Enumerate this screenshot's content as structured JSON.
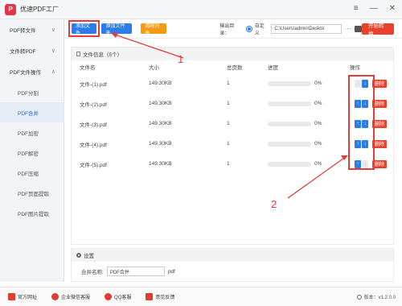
{
  "app": {
    "title": "优速PDF工厂",
    "logo_char": "P"
  },
  "window_controls": {
    "menu": "≡",
    "minimize": "—",
    "close": "✕"
  },
  "sidebar": {
    "groups": [
      {
        "label": "PDF转文件",
        "chevron": "∨"
      },
      {
        "label": "文件转PDF",
        "chevron": "∨"
      },
      {
        "label": "PDF文件操作",
        "chevron": "∧"
      }
    ],
    "items": [
      "PDF分割",
      "PDF合并",
      "PDF加密",
      "PDF解密",
      "PDF压缩",
      "PDF页面提取",
      "PDF图片提取"
    ],
    "active_index": 1
  },
  "toolbar": {
    "add_file": "添加文件",
    "add_folder": "添加文件夹",
    "clear_list": "清除列表",
    "output_label": "输出目录：",
    "custom_label": "自定义",
    "path_value": "C:\\Users\\admin\\Deskto",
    "more": "···",
    "start": "开始转换"
  },
  "file_panel": {
    "header": "文件信息（5个）",
    "columns": {
      "name": "文件名",
      "size": "大小",
      "pages": "总页数",
      "progress": "进度",
      "ops": "操作"
    },
    "rows": [
      {
        "name": "文件-(1).pdf",
        "size": "149.30KB",
        "pages": "1",
        "progress": "0%"
      },
      {
        "name": "文件-(2).pdf",
        "size": "149.30KB",
        "pages": "1",
        "progress": "0%"
      },
      {
        "name": "文件-(3).pdf",
        "size": "149.30KB",
        "pages": "1",
        "progress": "0%"
      },
      {
        "name": "文件-(4).pdf",
        "size": "149.30KB",
        "pages": "1",
        "progress": "0%"
      },
      {
        "name": "文件-(5).pdf",
        "size": "149.30KB",
        "pages": "1",
        "progress": "0%"
      }
    ],
    "delete_label": "删除",
    "up_glyph": "↑",
    "down_glyph": "↓"
  },
  "settings": {
    "header": "设置",
    "merge_label": "合并名称:",
    "merge_value": "PDF合并",
    "merge_ext": "pdf"
  },
  "footer": {
    "links": [
      "官方网址",
      "企业微信客服",
      "QQ客服",
      "意见反馈"
    ],
    "version": "版本：v1.2.0.0"
  },
  "annotations": {
    "label1": "1",
    "label2": "2"
  },
  "colors": {
    "accent_blue": "#2b7de9",
    "accent_red": "#e8412c",
    "accent_orange": "#f59b13",
    "annotation_red": "#e53b3b"
  }
}
